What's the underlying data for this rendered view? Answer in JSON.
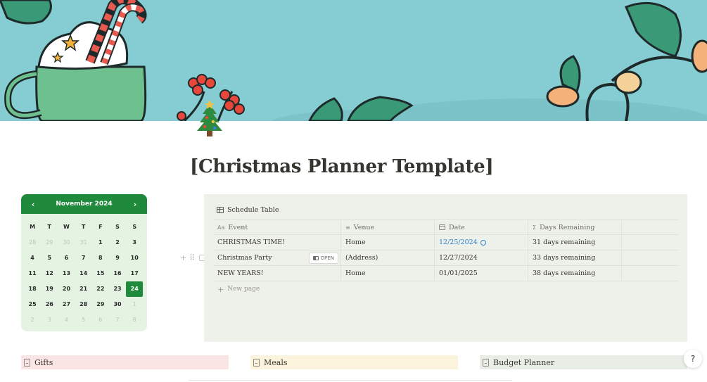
{
  "page": {
    "title": "[Christmas Planner Template]",
    "icon": "christmas-tree-icon"
  },
  "calendar": {
    "month_label": "November 2024",
    "prev_label": "‹",
    "next_label": "›",
    "weekdays": [
      "M",
      "T",
      "W",
      "T",
      "F",
      "S",
      "S"
    ],
    "weeks": [
      [
        {
          "d": "28",
          "m": true
        },
        {
          "d": "29",
          "m": true
        },
        {
          "d": "30",
          "m": true
        },
        {
          "d": "31",
          "m": true
        },
        {
          "d": "1"
        },
        {
          "d": "2"
        },
        {
          "d": "3"
        }
      ],
      [
        {
          "d": "4"
        },
        {
          "d": "5"
        },
        {
          "d": "6"
        },
        {
          "d": "7"
        },
        {
          "d": "8"
        },
        {
          "d": "9"
        },
        {
          "d": "10"
        }
      ],
      [
        {
          "d": "11"
        },
        {
          "d": "12"
        },
        {
          "d": "13"
        },
        {
          "d": "14"
        },
        {
          "d": "15"
        },
        {
          "d": "16"
        },
        {
          "d": "17"
        }
      ],
      [
        {
          "d": "18"
        },
        {
          "d": "19"
        },
        {
          "d": "20"
        },
        {
          "d": "21"
        },
        {
          "d": "22"
        },
        {
          "d": "23"
        },
        {
          "d": "24",
          "today": true
        }
      ],
      [
        {
          "d": "25"
        },
        {
          "d": "26"
        },
        {
          "d": "27"
        },
        {
          "d": "28"
        },
        {
          "d": "29"
        },
        {
          "d": "30"
        },
        {
          "d": "1",
          "m": true
        }
      ],
      [
        {
          "d": "2",
          "m": true
        },
        {
          "d": "3",
          "m": true
        },
        {
          "d": "4",
          "m": true
        },
        {
          "d": "5",
          "m": true
        },
        {
          "d": "6",
          "m": true
        },
        {
          "d": "7",
          "m": true
        },
        {
          "d": "8",
          "m": true
        }
      ]
    ],
    "accent_color": "#1f8a3b"
  },
  "schedule": {
    "title": "Schedule Table",
    "columns": [
      {
        "label": "Event",
        "icon": "Aa"
      },
      {
        "label": "Venue",
        "icon": "≡"
      },
      {
        "label": "Date",
        "icon": "calendar-icon"
      },
      {
        "label": "Days Remaining",
        "icon": "Σ"
      }
    ],
    "rows": [
      {
        "event": "CHRISTMAS TIME!",
        "venue": "Home",
        "date": "12/25/2024",
        "date_highlight": true,
        "days": "31 days remaining"
      },
      {
        "event": "Christmas Party",
        "venue": "(Address)",
        "date": "12/27/2024",
        "days": "33 days remaining",
        "show_open": true
      },
      {
        "event": "NEW YEARS!",
        "venue": "Home",
        "date": "01/01/2025",
        "days": "38 days remaining"
      }
    ],
    "open_label": "OPEN",
    "new_page_label": "New page"
  },
  "links": {
    "gifts": "Gifts",
    "meals": "Meals",
    "budget": "Budget Planner"
  },
  "help_label": "?"
}
